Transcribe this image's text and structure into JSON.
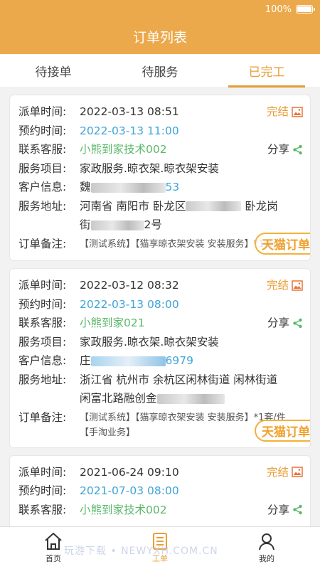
{
  "status": {
    "battery": "100%"
  },
  "header": {
    "title": "订单列表"
  },
  "tabs": [
    {
      "label": "待接单"
    },
    {
      "label": "待服务"
    },
    {
      "label": "已完工"
    }
  ],
  "labels": {
    "dispatch_time": "派单时间:",
    "appointment_time": "预约时间:",
    "contact_service": "联系客服:",
    "service_item": "服务项目:",
    "customer_info": "客户信息:",
    "service_address": "服务地址:",
    "order_note": "订单备注:"
  },
  "orders": [
    {
      "status": "完结",
      "dispatch_time": "2022-03-13 08:51",
      "appointment_time": "2022-03-13 11:00",
      "contact_service": "小熊到家技术002",
      "share": "分享",
      "service_item": "家政服务.晾衣架.晾衣架安装",
      "customer_prefix": "魏",
      "customer_suffix": "53",
      "address_line1_a": "河南省 南阳市 卧龙区",
      "address_line1_b": "卧龙岗",
      "address_line2_a": "街",
      "address_line2_b": "2号",
      "note": "【测试系统】【猫享晾衣架安装 安装服务】*1套/件",
      "badge": "天猫订单"
    },
    {
      "status": "完结",
      "dispatch_time": "2022-03-12 08:32",
      "appointment_time": "2022-03-13 08:00",
      "contact_service": "小熊到家021",
      "share": "分享",
      "service_item": "家政服务.晾衣架.晾衣架安装",
      "customer_prefix": "庄",
      "customer_suffix": "6979",
      "address_line1_a": "浙江省 杭州市 余杭区闲林街道 闲林街道",
      "address_line2_a": "闲富北路融创金",
      "note": "【测试系统】【猫享晾衣架安装 安装服务】*1套/件【手淘业务】",
      "badge": "天猫订单"
    },
    {
      "status": "完结",
      "dispatch_time": "2021-06-24 09:10",
      "appointment_time": "2021-07-03 08:00",
      "contact_service": "小熊到家技术002",
      "share": "分享"
    }
  ],
  "tabbar": [
    {
      "label": "首页"
    },
    {
      "label": "工单"
    },
    {
      "label": "我的"
    }
  ],
  "watermark": "玩游下载 • NEWYXH.COM.CN",
  "colors": {
    "primary": "#eca94b",
    "accent": "#e99e35",
    "link": "#3fa4d8",
    "green": "#5bb86b"
  }
}
